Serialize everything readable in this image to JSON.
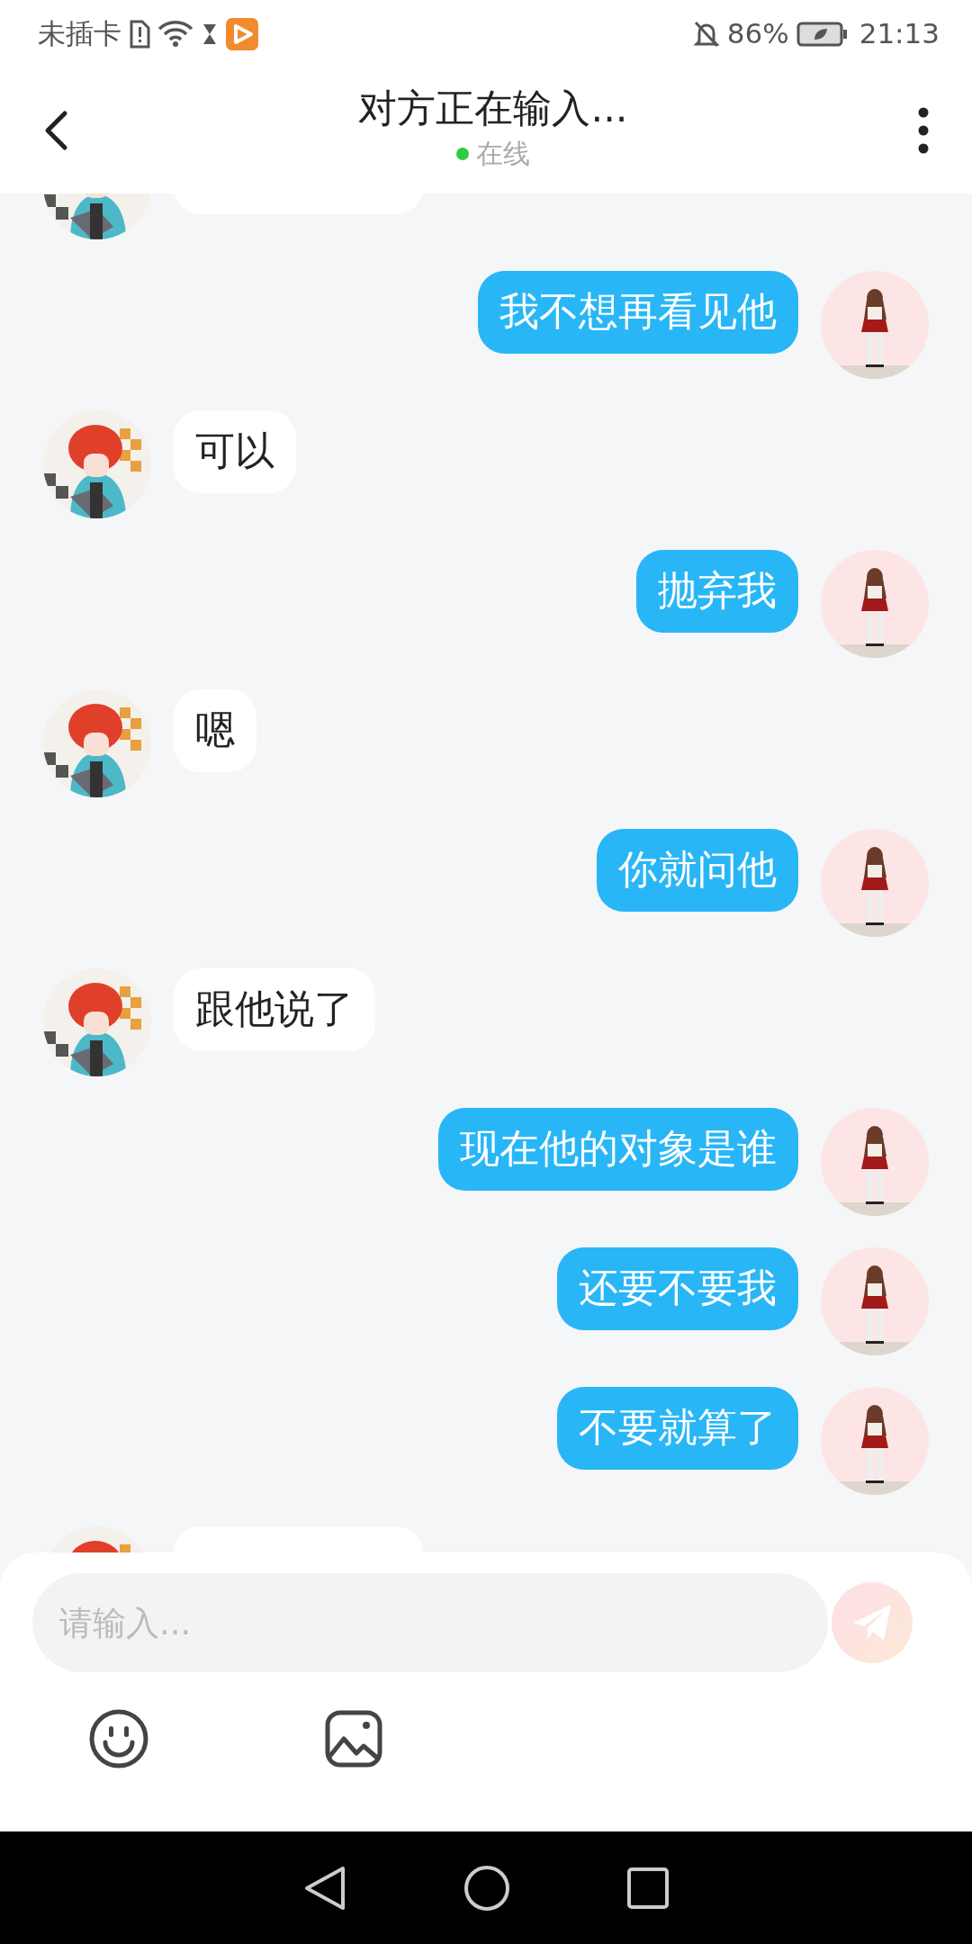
{
  "status_bar": {
    "carrier": "未插卡",
    "battery": "86%",
    "time": "21:13"
  },
  "header": {
    "title": "对方正在输入...",
    "status": "在线"
  },
  "messages": [
    {
      "kind": "incoming"
    },
    {
      "kind": "outgoing",
      "text": "我不想再看见他"
    },
    {
      "kind": "incoming",
      "text": "可以"
    },
    {
      "kind": "outgoing",
      "text": "抛弃我"
    },
    {
      "kind": "incoming",
      "text": "嗯"
    },
    {
      "kind": "outgoing",
      "text": "你就问他"
    },
    {
      "kind": "incoming",
      "text": "跟他说了"
    },
    {
      "kind": "outgoing",
      "text": "现在他的对象是谁"
    },
    {
      "kind": "outgoing",
      "text": "还要不要我"
    },
    {
      "kind": "outgoing",
      "text": "不要就算了"
    },
    {
      "kind": "incoming"
    }
  ],
  "composer": {
    "placeholder": "请输入..."
  }
}
